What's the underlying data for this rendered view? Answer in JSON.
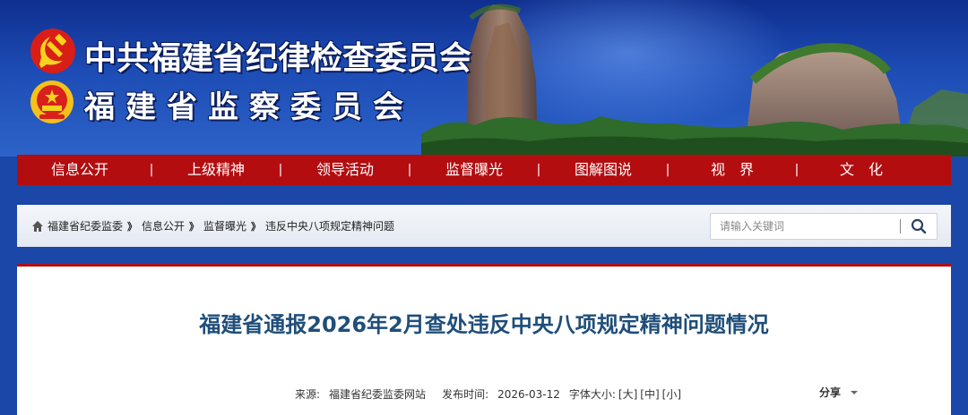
{
  "header": {
    "title_line1": "中共福建省纪律检查委员会",
    "title_line2": "福建省监察委员会",
    "party_emblem_icon": "party-emblem-icon",
    "national_emblem_icon": "national-emblem-icon"
  },
  "nav": {
    "items": [
      {
        "label": "信息公开"
      },
      {
        "label": "上级精神"
      },
      {
        "label": "领导活动"
      },
      {
        "label": "监督曝光"
      },
      {
        "label": "图解图说"
      },
      {
        "label": "视　界"
      },
      {
        "label": "文　化"
      }
    ],
    "separator": "|"
  },
  "breadcrumb": {
    "home_icon": "home-icon",
    "items": [
      {
        "label": "福建省纪委监委"
      },
      {
        "label": "信息公开"
      },
      {
        "label": "监督曝光"
      },
      {
        "label": "违反中央八项规定精神问题"
      }
    ],
    "separator": "》"
  },
  "search": {
    "placeholder": "请输入关键词",
    "icon": "search-icon"
  },
  "article": {
    "title": "福建省通报2026年2月查处违反中央八项规定精神问题情况",
    "source_label": "来源:",
    "source_value": "福建省纪委监委网站",
    "date_label": "发布时间:",
    "date_value": "2026-03-12",
    "font_size_label": "字体大小:",
    "font_size_options": [
      "[大]",
      "[中]",
      "[小]"
    ],
    "share_label": "分享"
  },
  "colors": {
    "nav_red": "#b30d10",
    "banner_blue": "#1a47a8",
    "title_blue": "#1f4e7a"
  }
}
